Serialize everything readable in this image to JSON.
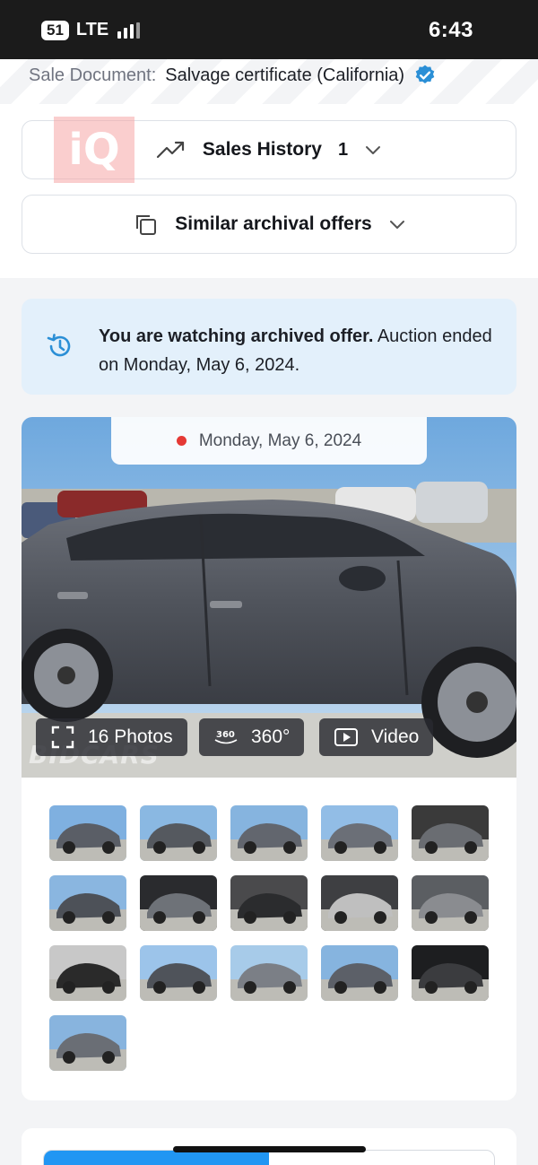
{
  "status_bar": {
    "badge": "51",
    "network": "LTE",
    "time": "6:43"
  },
  "sale_document": {
    "label": "Sale Document:",
    "value": "Salvage certificate (California)"
  },
  "logo": {
    "text": "iQ"
  },
  "sales_history": {
    "label": "Sales History",
    "count": "1",
    "icon": "trending-up-icon"
  },
  "similar_offers": {
    "label": "Similar archival offers",
    "icon": "copy-icon"
  },
  "archive_notice": {
    "bold": "You are watching archived offer.",
    "text": " Auction ended on Monday, May 6, 2024."
  },
  "gallery": {
    "date": "Monday, May 6, 2024",
    "watermark": "BIDCARS",
    "photos_label": "16 Photos",
    "view360_label": "360°",
    "video_label": "Video",
    "thumbnails": [
      "front-left",
      "front-left-angle",
      "front-right",
      "rear-right",
      "interior-front",
      "rear-damage",
      "dashboard-cluster",
      "rear-seats",
      "vin-label",
      "engine-bay",
      "key-fob",
      "front-view",
      "side-left",
      "rear-left",
      "instrument-cluster",
      "rear-damaged"
    ]
  },
  "bottom": {
    "progress": 0.5
  },
  "colors": {
    "accent": "#2196f3",
    "banner": "#e3f0fb",
    "icon_blue": "#2b8fd6"
  }
}
